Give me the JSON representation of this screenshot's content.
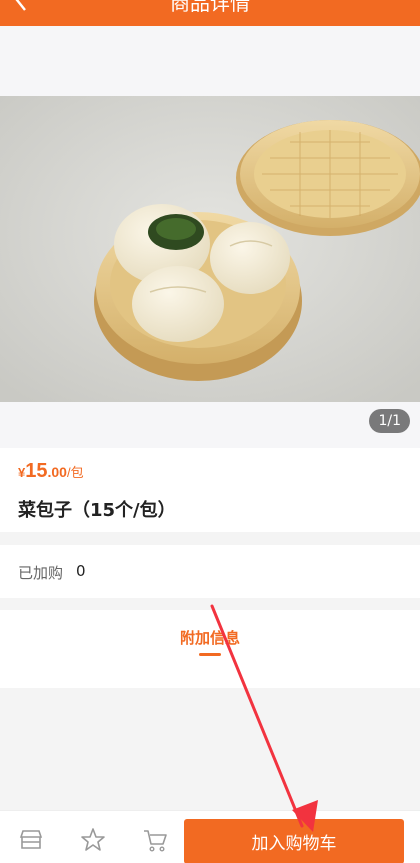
{
  "header": {
    "title": "商品详情"
  },
  "gallery": {
    "counter": "1/1"
  },
  "product": {
    "price_symbol": "¥",
    "price_integer": "15",
    "price_decimal": ".00",
    "price_unit": "/包",
    "name": "菜包子（15个/包）"
  },
  "purchased": {
    "label": "已加购",
    "count": "0"
  },
  "extra_info": {
    "tab_label": "附加信息"
  },
  "bottom_bar": {
    "icons": [
      "store-icon",
      "star-icon",
      "cart-icon"
    ],
    "add_to_cart_label": "加入购物车"
  },
  "colors": {
    "accent": "#f26a22",
    "annotation_arrow": "#f2333f"
  }
}
